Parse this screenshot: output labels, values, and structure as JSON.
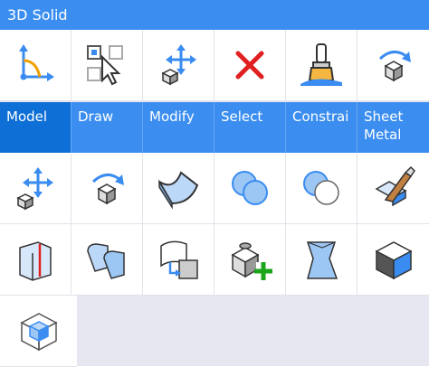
{
  "panel": {
    "title": "3D Solid",
    "top_tools": [
      {
        "name": "ucs-icon"
      },
      {
        "name": "select-cursor-icon"
      },
      {
        "name": "move-3d-icon"
      },
      {
        "name": "delete-icon"
      },
      {
        "name": "paint-brush-icon"
      },
      {
        "name": "rotate-3d-icon"
      }
    ],
    "tabs": [
      {
        "label": "Model",
        "active": true
      },
      {
        "label": "Draw"
      },
      {
        "label": "Modify"
      },
      {
        "label": "Select"
      },
      {
        "label": "Constrai"
      },
      {
        "label": "Sheet Metal"
      }
    ],
    "tools_row1": [
      {
        "name": "move-icon"
      },
      {
        "name": "rotate-icon"
      },
      {
        "name": "surface-icon"
      },
      {
        "name": "union-icon"
      },
      {
        "name": "subtract-icon"
      },
      {
        "name": "slice-icon"
      }
    ],
    "tools_row2": [
      {
        "name": "section-solid-icon"
      },
      {
        "name": "copy-solid-icon"
      },
      {
        "name": "extrude-face-icon"
      },
      {
        "name": "add-primitive-icon"
      },
      {
        "name": "twist-solid-icon"
      },
      {
        "name": "box-solid-icon"
      }
    ],
    "tools_row3": [
      {
        "name": "wireframe-box-icon"
      }
    ]
  },
  "colors": {
    "accent": "#3b8ef0",
    "accent_active": "#0e6fd6",
    "icon_blue": "#3a8cf0",
    "delete_red": "#e02020",
    "add_green": "#1aa51a"
  }
}
